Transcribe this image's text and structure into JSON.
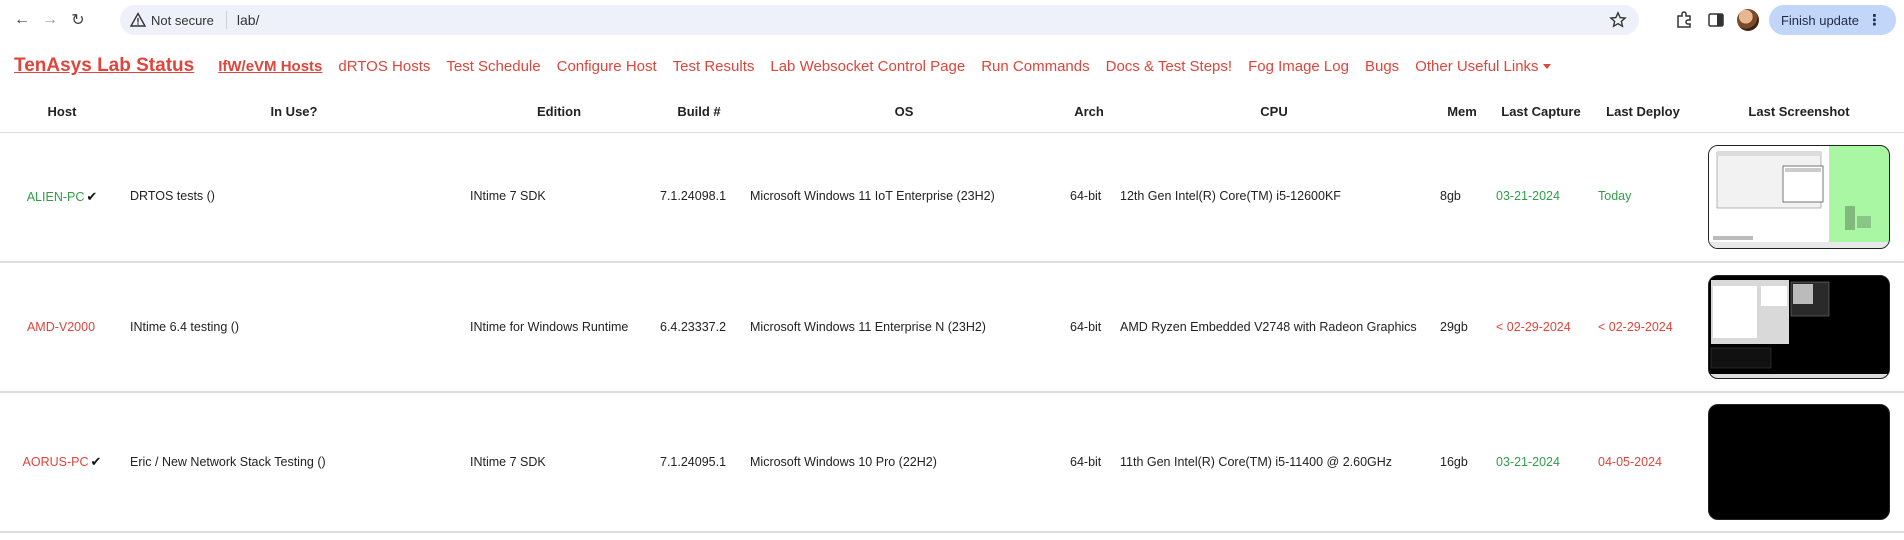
{
  "browser": {
    "not_secure": "Not secure",
    "url": "lab/",
    "finish_update": "Finish update"
  },
  "nav": {
    "brand": "TenAsys Lab Status",
    "links": [
      {
        "label": "IfW/eVM Hosts",
        "active": true
      },
      {
        "label": "dRTOS Hosts"
      },
      {
        "label": "Test Schedule"
      },
      {
        "label": "Configure Host"
      },
      {
        "label": "Test Results"
      },
      {
        "label": "Lab Websocket Control Page"
      },
      {
        "label": "Run Commands"
      },
      {
        "label": "Docs & Test Steps!"
      },
      {
        "label": "Fog Image Log"
      },
      {
        "label": "Bugs"
      },
      {
        "label": "Other Useful Links"
      }
    ]
  },
  "table": {
    "headers": [
      "Host",
      "In Use?",
      "Edition",
      "Build #",
      "OS",
      "Arch",
      "CPU",
      "Mem",
      "Last Capture",
      "Last Deploy",
      "Last Screenshot"
    ],
    "rows": [
      {
        "host": "ALIEN-PC",
        "host_status": "green",
        "checked": "✔",
        "in_use": "DRTOS tests ()",
        "edition": "INtime 7 SDK",
        "build": "7.1.24098.1",
        "os": "Microsoft Windows 11 IoT Enterprise (23H2)",
        "arch": "64-bit",
        "cpu": "12th Gen Intel(R) Core(TM) i5-12600KF",
        "mem": "8gb",
        "last_capture": "03-21-2024",
        "capture_status": "green",
        "last_deploy": "Today",
        "deploy_status": "green"
      },
      {
        "host": "AMD-V2000",
        "host_status": "red",
        "checked": "",
        "in_use": "INtime 6.4 testing ()",
        "edition": "INtime for Windows Runtime",
        "build": "6.4.23337.2",
        "os": "Microsoft Windows 11 Enterprise N (23H2)",
        "arch": "64-bit",
        "cpu": "AMD Ryzen Embedded V2748 with Radeon Graphics",
        "mem": "29gb",
        "last_capture": "< 02-29-2024",
        "capture_status": "red",
        "last_deploy": "< 02-29-2024",
        "deploy_status": "red"
      },
      {
        "host": "AORUS-PC",
        "host_status": "red",
        "checked": "✔",
        "in_use": "Eric / New Network Stack Testing ()",
        "edition": "INtime 7 SDK",
        "build": "7.1.24095.1",
        "os": "Microsoft Windows 10 Pro (22H2)",
        "arch": "64-bit",
        "cpu": "11th Gen Intel(R) Core(TM) i5-11400 @ 2.60GHz",
        "mem": "16gb",
        "last_capture": "03-21-2024",
        "capture_status": "green",
        "last_deploy": "04-05-2024",
        "deploy_status": "red"
      }
    ]
  },
  "colors": {
    "accent": "#e0443a",
    "ok": "#2e9e48"
  }
}
